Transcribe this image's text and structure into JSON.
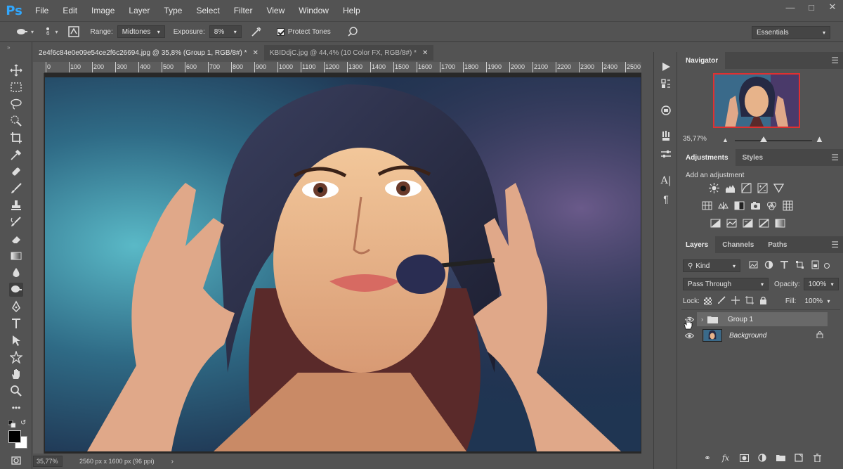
{
  "app": {
    "logo": "Ps",
    "menu": [
      "File",
      "Edit",
      "Image",
      "Layer",
      "Type",
      "Select",
      "Filter",
      "View",
      "Window",
      "Help"
    ],
    "window_controls": [
      "minimize-icon",
      "restore-icon",
      "close-icon"
    ]
  },
  "options": {
    "brush_size": "6",
    "range_label": "Range:",
    "range_value": "Midtones",
    "exposure_label": "Exposure:",
    "exposure_value": "8%",
    "protect_tones_label": "Protect Tones",
    "protect_tones_checked": true,
    "workspace": "Essentials"
  },
  "tabs": [
    {
      "title": "2e4f6c84e0e09e54ce2f6c26694.jpg @ 35,8% (Group 1, RGB/8#) *",
      "active": true
    },
    {
      "title": "KBIDdjC.jpg @ 44,4% (10 Color FX, RGB/8#) *",
      "active": false
    }
  ],
  "ruler": {
    "ticks": [
      "0",
      "100",
      "200",
      "300",
      "400",
      "500",
      "600",
      "700",
      "800",
      "900",
      "1000",
      "1100",
      "1200",
      "1300",
      "1400",
      "1500",
      "1600",
      "1700",
      "1800",
      "1900",
      "2000",
      "2100",
      "2200",
      "2300",
      "2400",
      "2500"
    ]
  },
  "status": {
    "zoom": "35,77%",
    "doc_size": "2560 px x 1600 px (96 ppi)"
  },
  "navigator": {
    "title": "Navigator",
    "zoom": "35,77%"
  },
  "adjustments": {
    "tabs": [
      "Adjustments",
      "Styles"
    ],
    "hint": "Add an adjustment"
  },
  "layers_panel": {
    "tabs": [
      "Layers",
      "Channels",
      "Paths"
    ],
    "kind_label": "Kind",
    "blend_mode": "Pass Through",
    "opacity_label": "Opacity:",
    "opacity_value": "100%",
    "lock_label": "Lock:",
    "fill_label": "Fill:",
    "fill_value": "100%",
    "layers": [
      {
        "name": "Group 1",
        "type": "group",
        "visible": true,
        "selected": true
      },
      {
        "name": "Background",
        "type": "image",
        "visible": true,
        "locked": true
      }
    ]
  },
  "colors": {
    "ps_blue": "#31a8ff",
    "panel_bg": "#535353",
    "nav_frame": "#e03030"
  }
}
